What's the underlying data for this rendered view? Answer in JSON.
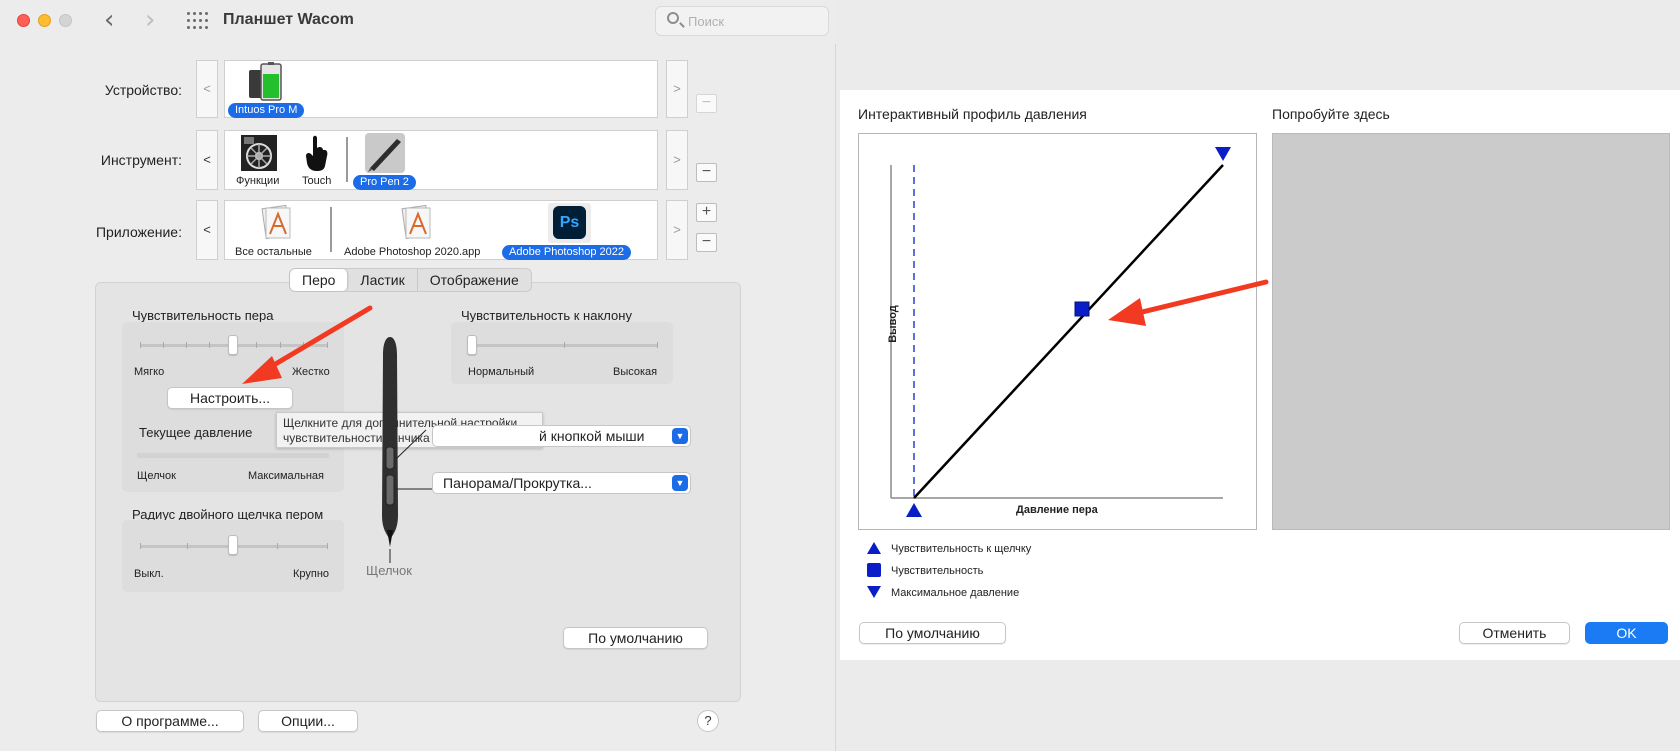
{
  "left_window": {
    "title": "Планшет Wacom",
    "search_placeholder": "Поиск",
    "device": {
      "label": "Устройство:",
      "items": [
        {
          "name": "Intuos Pro M",
          "selected": true
        }
      ]
    },
    "tool": {
      "label": "Инструмент:",
      "items": [
        {
          "name": "Функции",
          "selected": false
        },
        {
          "name": "Touch",
          "selected": false
        },
        {
          "name": "Pro Pen 2",
          "selected": true
        }
      ]
    },
    "application": {
      "label": "Приложение:",
      "items": [
        {
          "name": "Все остальные",
          "selected": false
        },
        {
          "name": "Adobe Photoshop 2020.app",
          "selected": false
        },
        {
          "name": "Adobe Photoshop 2022",
          "selected": true
        }
      ],
      "ps_icon_text": "Ps"
    },
    "strip_prev": "<",
    "strip_next": ">",
    "minus": "−",
    "plus": "+",
    "tabs": [
      {
        "label": "Перо",
        "active": true
      },
      {
        "label": "Ластик",
        "active": false
      },
      {
        "label": "Отображение",
        "active": false
      }
    ],
    "pen_sensitivity": {
      "title": "Чувствительность пера",
      "min_label": "Мягко",
      "max_label": "Жестко",
      "customize_button": "Настроить..."
    },
    "tooltip": "Щелкните для дополнительной настройки чувствительности кончика пера.",
    "current_pressure": {
      "title": "Текущее давление",
      "min_label": "Щелчок",
      "max_label": "Максимальная"
    },
    "double_click_radius": {
      "title": "Радиус двойного щелчка пером",
      "min_label": "Выкл.",
      "max_label": "Крупно"
    },
    "tilt_sensitivity": {
      "title": "Чувствительность к наклону",
      "min_label": "Нормальный",
      "max_label": "Высокая"
    },
    "upper_button_popup": "й кнопкой мыши",
    "lower_button_popup": "Панорама/Прокрутка...",
    "pen_tip_label": "Щелчок",
    "default_button": "По умолчанию",
    "about_button": "О программе...",
    "options_button": "Опции...",
    "help_button": "?"
  },
  "right_window": {
    "profile_title": "Интерактивный профиль давления",
    "try_title": "Попробуйте здесь",
    "chart": {
      "ylabel": "Вывод",
      "xlabel": "Давление пера"
    },
    "legend": [
      {
        "icon": "triangle-up-icon",
        "label": "Чувствительность к щелчку"
      },
      {
        "icon": "square-icon",
        "label": "Чувствительность"
      },
      {
        "icon": "triangle-down-icon",
        "label": "Максимальное давление"
      }
    ],
    "default_button": "По умолчанию",
    "cancel_button": "Отменить",
    "ok_button": "OK"
  },
  "colors": {
    "accent": "#1b6ce6",
    "curve_marker": "#0a1ec8",
    "annotation_arrow": "#f23a22"
  }
}
